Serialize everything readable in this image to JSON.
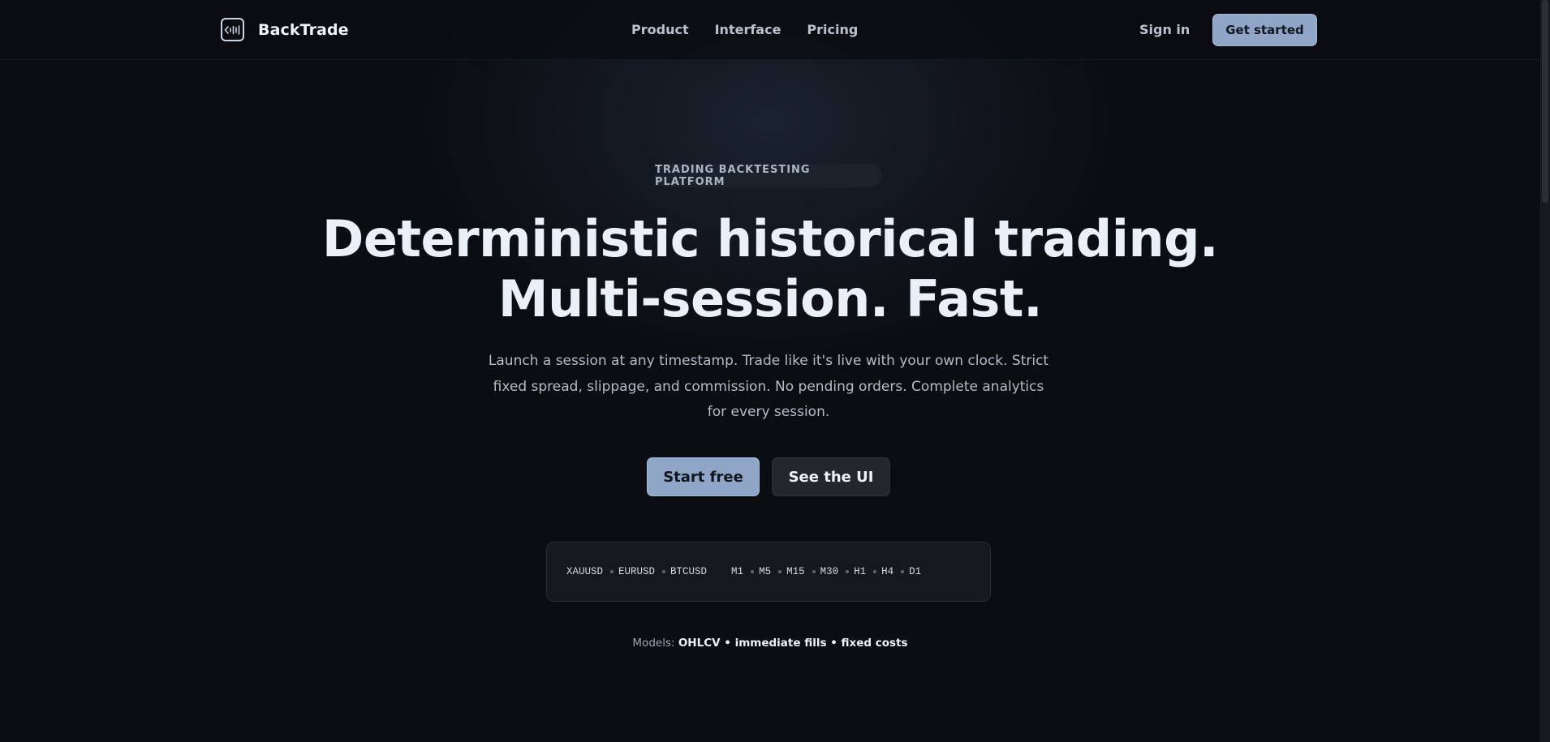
{
  "header": {
    "brand": "BackTrade",
    "logo_icon": "chart-logo-icon",
    "nav": [
      "Product",
      "Interface",
      "Pricing"
    ],
    "sign_in": "Sign in",
    "get_started": "Get started"
  },
  "hero": {
    "badge": "TRADING BACKTESTING PLATFORM",
    "title_line1": "Deterministic historical trading.",
    "title_line2": "Multi-session. Fast.",
    "subtitle": "Launch a session at any timestamp. Trade like it's live with your own clock. Strict fixed spread, slippage, and commission. No pending orders. Complete analytics for every session.",
    "primary_cta": "Start free",
    "secondary_cta": "See the UI"
  },
  "ticker": {
    "symbols": [
      "XAUUSD",
      "EURUSD",
      "BTCUSD"
    ],
    "timeframes": [
      "M1",
      "M5",
      "M15",
      "M30",
      "H1",
      "H4",
      "D1"
    ]
  },
  "models": {
    "label": "Models:",
    "value": "OHLCV • immediate fills • fixed costs"
  },
  "colors": {
    "background": "#0a0d12",
    "accent": "#8fa6c6",
    "secondary_button": "#22262d"
  }
}
